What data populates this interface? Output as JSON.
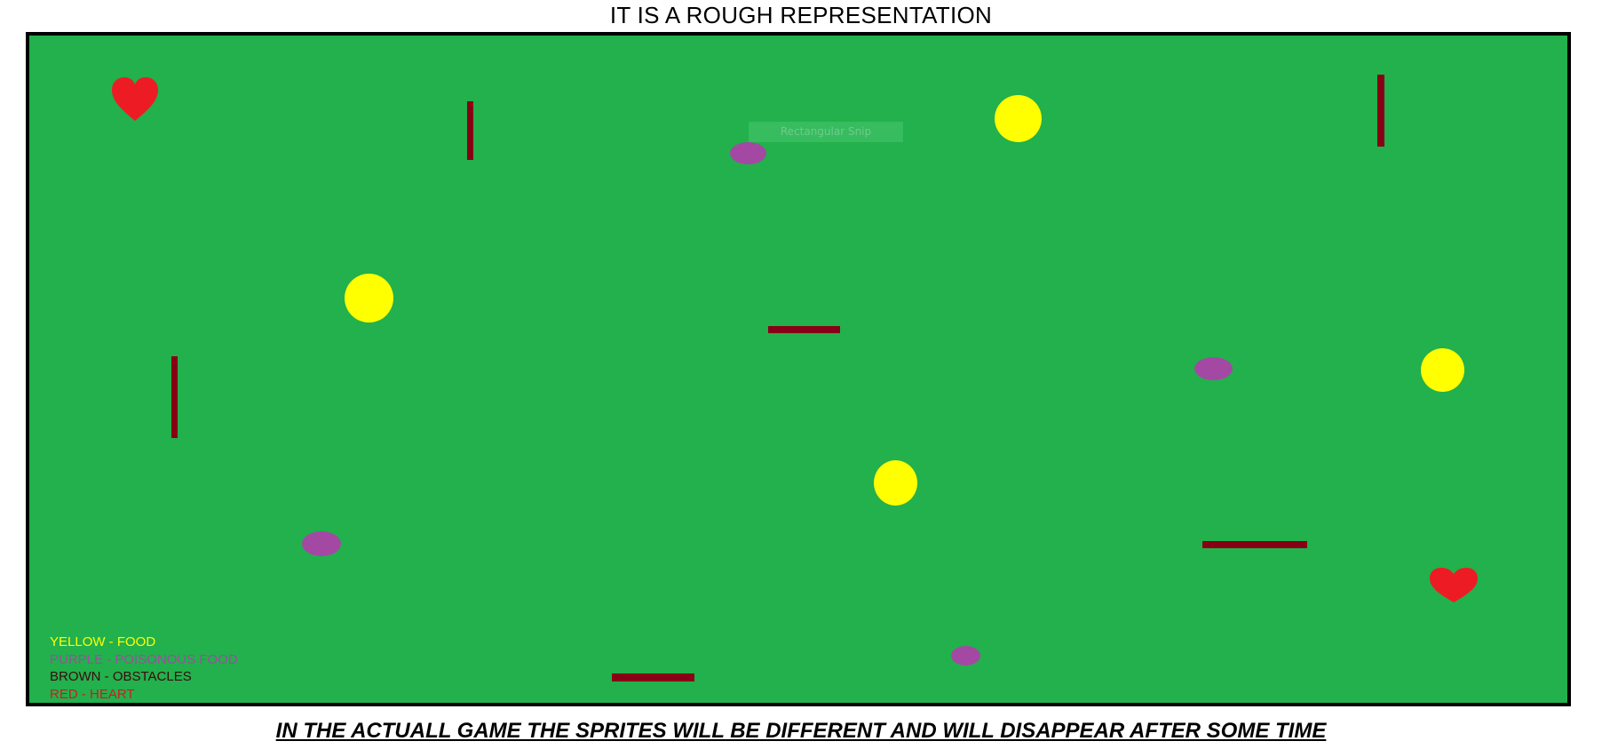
{
  "header": {
    "title": "IT IS A ROUGH REPRESENTATION"
  },
  "snip_tooltip": {
    "label": "Rectangular Snip"
  },
  "legend": [
    {
      "label": "YELLOW - FOOD",
      "color": "#ffff00"
    },
    {
      "label": "PURPLE - POISONOUS FOOD",
      "color": "#a349a4"
    },
    {
      "label": "BROWN - OBSTACLES",
      "color": "#880015"
    },
    {
      "label": "RED - HEART",
      "color": "#ed1c24"
    }
  ],
  "sprites": {
    "food_color": "#ffff00",
    "poison_color": "#a349a4",
    "obstacle_color": "#880015",
    "heart_color": "#ed1c24",
    "field_color": "#22b14c"
  },
  "footer": {
    "note": "IN THE ACTUALL GAME THE SPRITES WILL BE DIFFERENT AND WILL DISAPPEAR AFTER SOME TIME"
  }
}
